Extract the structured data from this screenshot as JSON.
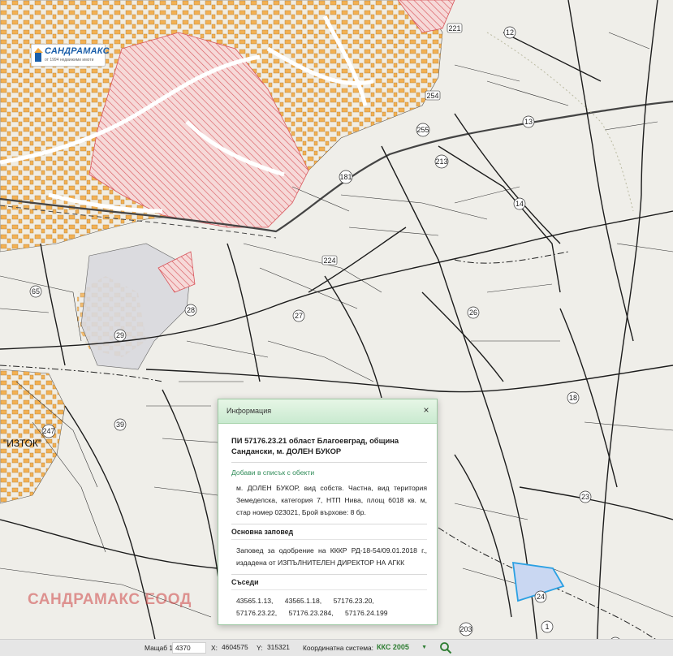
{
  "map": {
    "logo_text": "САНДРАМАКС",
    "logo_subtext": "от 1994 недвижими имоти",
    "watermark": "САНДРАМАКС ЕООД",
    "place_label": "\"ИЗТОК\"",
    "parcel_numbers": [
      "12",
      "221",
      "13",
      "254",
      "255",
      "213",
      "14",
      "181",
      "224",
      "27",
      "26",
      "28",
      "29",
      "65",
      "18",
      "39",
      "247",
      "23",
      "24",
      "203",
      "1",
      "96"
    ],
    "colors": {
      "background": "#efeee9",
      "buildings": "#f2a53a",
      "hatch_zone": "#d8555b",
      "selected_parcel_fill": "#c9d7f2",
      "selected_parcel_stroke": "#2aa0e3",
      "boundary": "#1c1c1c",
      "gray_zone": "#d9d9de",
      "panel_header": "#c9ead0",
      "link": "#2e8b57"
    }
  },
  "info_panel": {
    "header_title": "Информация",
    "close_glyph": "×",
    "title": "ПИ 57176.23.21 област Благоевград, община Сандански, м. ДОЛЕН БУКОР",
    "add_link": "Добави в списък с обекти",
    "description": "м. ДОЛЕН БУКОР, вид собств. Частна, вид територия Земеделска, категория 7, НТП Нива, площ 6018 кв. м, стар номер 023021, Брой върхове: 8 бр.",
    "order_heading": "Основна заповед",
    "order_text": "Заповед за одобрение на КККР РД-18-54/09.01.2018 г., издадена от ИЗПЪЛНИТЕЛЕН ДИРЕКТОР НА АГКК",
    "neighbors_heading": "Съседи",
    "neighbors": [
      "43565.1.13,",
      "43565.1.18,",
      "57176.23.20,",
      "57176.23.22,",
      "57176.23.284,",
      "57176.24.199"
    ]
  },
  "status_bar": {
    "scale_label": "Мащаб 1:",
    "scale_value": "4370",
    "x_label": "X:",
    "x_value": "4604575",
    "y_label": "Y:",
    "y_value": "315321",
    "coord_system_label": "Координатна система:",
    "coord_system_value": "ККС 2005",
    "dropdown_icon": "chevron-down-icon",
    "search_icon": "search-icon"
  }
}
